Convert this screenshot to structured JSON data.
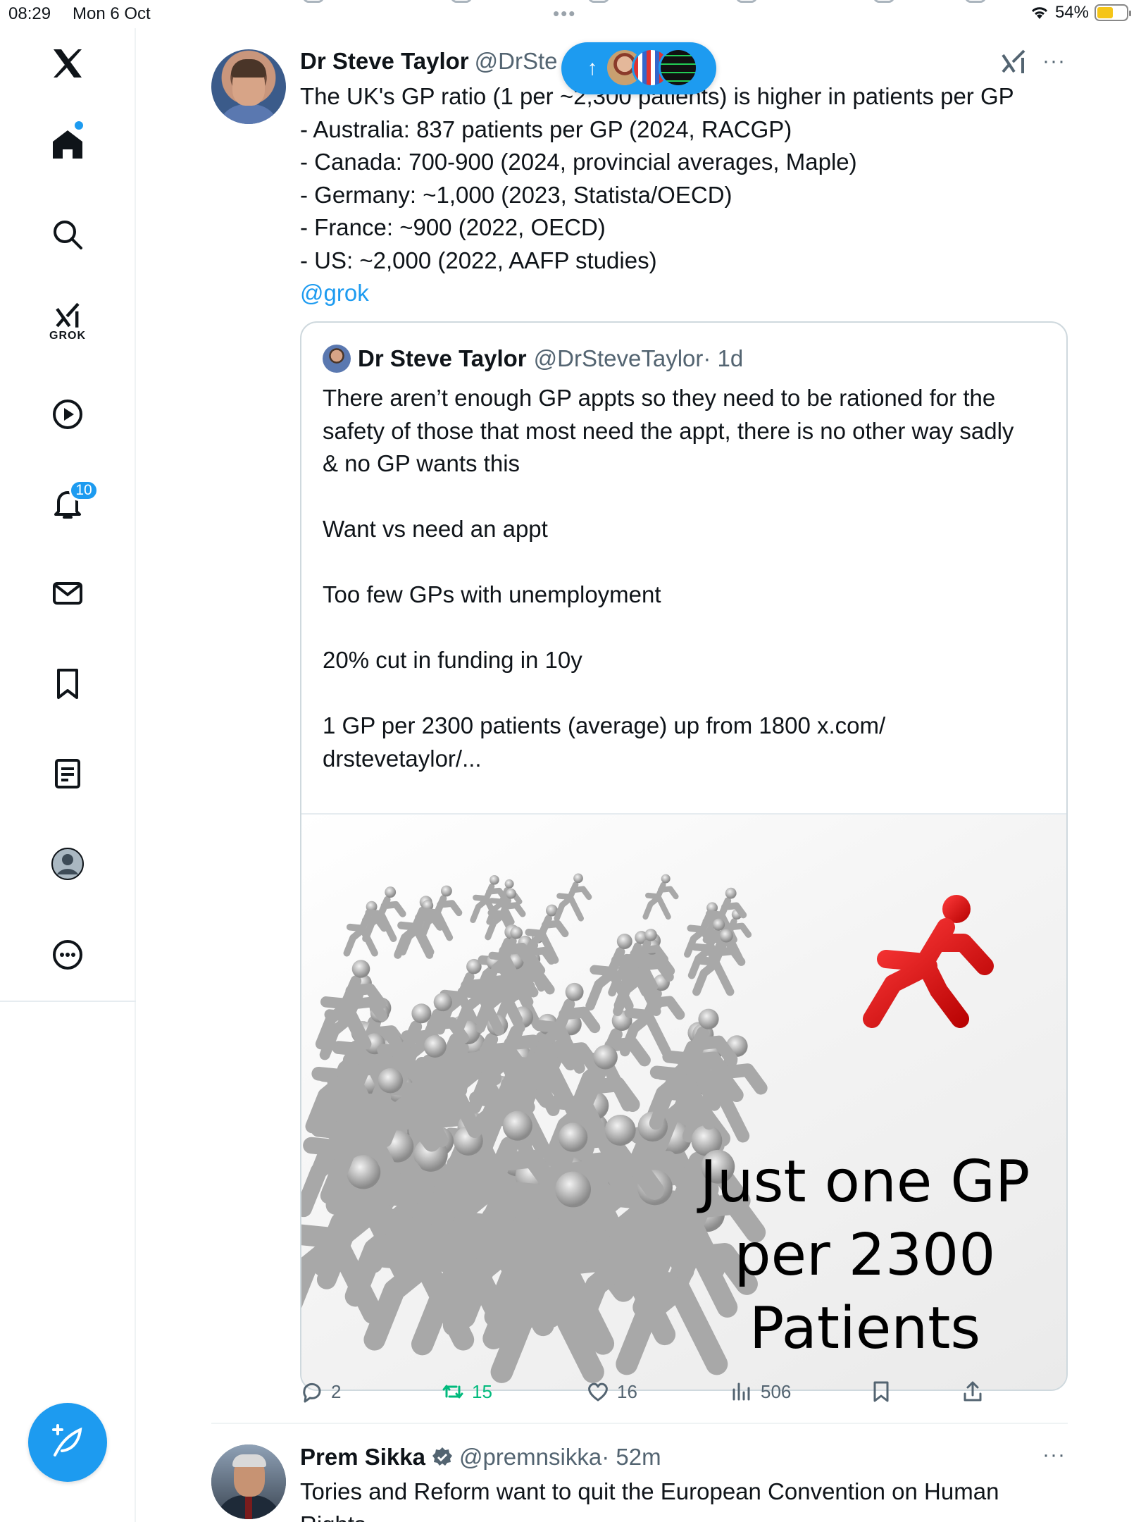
{
  "status_bar": {
    "time": "08:29",
    "date": "Mon 6 Oct",
    "battery_percent": "54%",
    "battery_level": 0.54
  },
  "sidebar": {
    "items": [
      {
        "name": "x-logo",
        "icon": "x-logo-icon"
      },
      {
        "name": "home",
        "icon": "home-icon",
        "has_dot": true
      },
      {
        "name": "explore",
        "icon": "search-icon"
      },
      {
        "name": "grok",
        "icon": "grok-icon",
        "label": "GROK"
      },
      {
        "name": "videos",
        "icon": "play-icon"
      },
      {
        "name": "notifications",
        "icon": "bell-icon",
        "badge": "10"
      },
      {
        "name": "messages",
        "icon": "envelope-icon"
      },
      {
        "name": "bookmarks",
        "icon": "bookmark-icon"
      },
      {
        "name": "articles",
        "icon": "document-icon"
      },
      {
        "name": "profile",
        "icon": "profile-icon"
      },
      {
        "name": "more",
        "icon": "more-circle-icon"
      }
    ],
    "compose_icon": "compose-feather-icon"
  },
  "new_posts_pill": {
    "arrow": "↑",
    "avatars": 3
  },
  "tweet": {
    "author_name": "Dr Steve Taylor",
    "author_handle": "@DrSte",
    "more": "···",
    "body_lines": [
      "The UK's GP ratio (1 per ~2,300 patients) is higher in patients per GP",
      "- Australia: 837 patients per GP (2024, RACGP)",
      "- Canada: 700-900 (2024, provincial averages, Maple)",
      "- Germany: ~1,000 (2023, Statista/OECD)",
      "- France: ~900 (2022, OECD)",
      "- US: ~2,000 (2022, AAFP studies)"
    ],
    "mention": "@grok",
    "quote": {
      "author_name": "Dr Steve Taylor",
      "author_handle": "@DrSteveTaylor",
      "time": "· 1d",
      "lines": [
        "There aren’t enough GP appts so they need to be rationed for the",
        "safety of those that most need the appt, there is no other way sadly",
        "& no GP wants this",
        "",
        "Want vs need an appt",
        "",
        "Too few GPs with unemployment",
        "",
        "20% cut in funding in 10y",
        "",
        "1 GP per 2300 patients (average) up from 1800 x.com/",
        "drstevetaylor/..."
      ],
      "image_caption": [
        "Just one GP",
        "per 2300",
        "Patients"
      ]
    },
    "actions": {
      "replies": "2",
      "reposts": "15",
      "likes": "16",
      "views": "506"
    },
    "colors": {
      "accent": "#1d9bf0",
      "repost": "#00ba7c",
      "muted": "#536471"
    }
  },
  "next_tweet": {
    "author_name": "Prem Sikka",
    "author_handle": "@premnsikka",
    "time": "· 52m",
    "more": "···",
    "verified_icon": "verified-badge-icon",
    "body_lines": [
      "Tories and Reform want to quit the European Convention on Human",
      "Rights"
    ]
  }
}
